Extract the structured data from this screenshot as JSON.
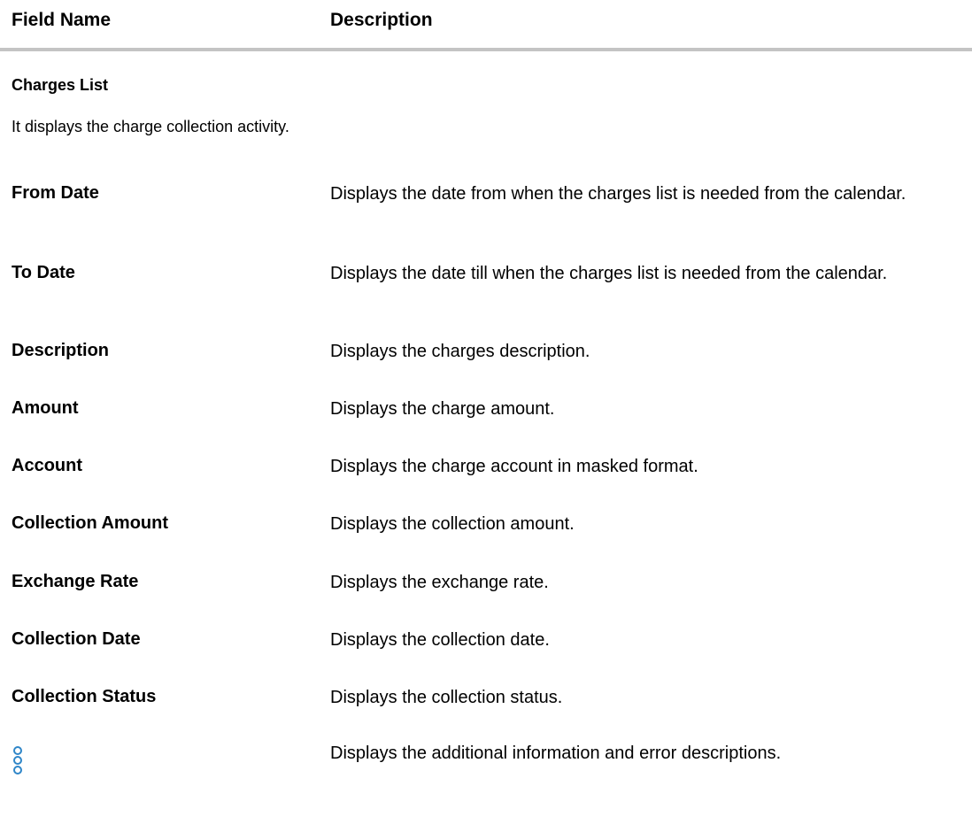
{
  "table": {
    "headers": {
      "field": "Field Name",
      "description": "Description"
    },
    "section": {
      "title": "Charges List",
      "description": "It displays the charge collection activity."
    },
    "rows": [
      {
        "name": "From Date",
        "description": "Displays the date from when the charges list is needed from the calendar."
      },
      {
        "name": "To Date",
        "description": "Displays the date till when the charges list is needed from the calendar."
      },
      {
        "name": "Description",
        "description": "Displays the charges description."
      },
      {
        "name": "Amount",
        "description": "Displays the charge amount."
      },
      {
        "name": "Account",
        "description": "Displays the charge account in masked format."
      },
      {
        "name": "Collection Amount",
        "description": "Displays the collection amount."
      },
      {
        "name": "Exchange Rate",
        "description": "Displays the exchange rate."
      },
      {
        "name": "Collection Date",
        "description": "Displays the collection date."
      },
      {
        "name": "Collection Status",
        "description": "Displays the collection status."
      }
    ],
    "icon_row": {
      "icon": "more-options-vertical-dots-icon",
      "description": "Displays the additional information and error descriptions."
    }
  },
  "colors": {
    "header_rule": "#c4c4c4",
    "icon_accent": "#2f86c8"
  }
}
